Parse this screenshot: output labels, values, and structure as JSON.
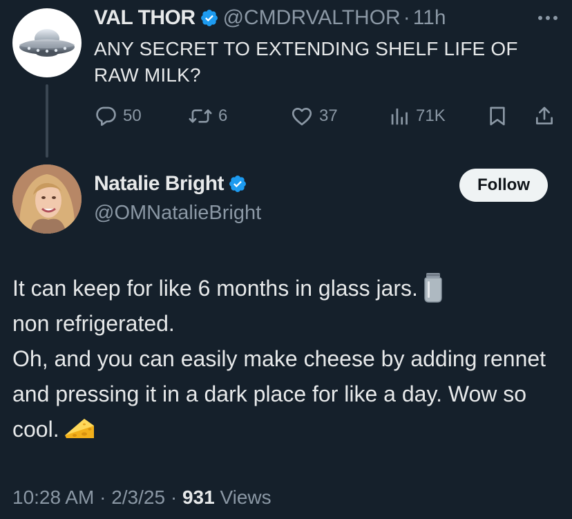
{
  "parent_tweet": {
    "author_name": "VAL THOR",
    "handle": "@CMDRVALTHOR",
    "separator": "·",
    "time": "11h",
    "text": "ANY SECRET TO EXTENDING SHELF LIFE OF RAW MILK?",
    "avatar_icon": "ufo-icon",
    "actions": {
      "replies": "50",
      "reposts": "6",
      "likes": "37",
      "views": "71K"
    }
  },
  "reply_tweet": {
    "author_name": "Natalie Bright",
    "handle": "@OMNatalieBright",
    "follow_label": "Follow",
    "body_line1": "It can keep for like 6 months in glass jars.",
    "body_line2": "non refrigerated.",
    "body_line3": "Oh, and you can easily make cheese by adding rennet and pressing it in a dark place for like a day. Wow so cool.",
    "emoji1": "glass-jar-emoji",
    "emoji2": "cheese-wedge-emoji",
    "meta": {
      "time": "10:28 AM",
      "sep1": "·",
      "date": "2/3/25",
      "sep2": "·",
      "views_count": "931",
      "views_label": "Views"
    }
  },
  "colors": {
    "background": "#15202b",
    "text_primary": "#e7e9ea",
    "text_secondary": "#8b98a5",
    "verified_blue": "#1d9bf0",
    "follow_bg": "#eff3f4",
    "thread_line": "#3a4652"
  }
}
